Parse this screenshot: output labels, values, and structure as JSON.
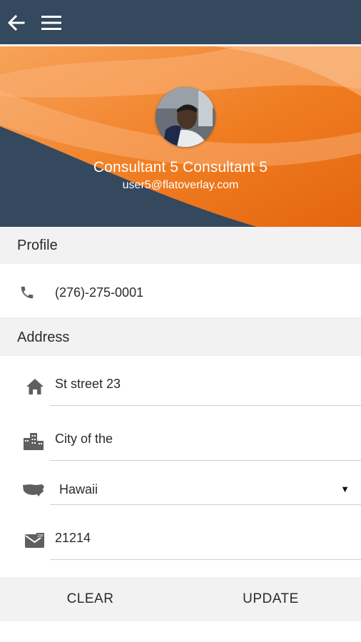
{
  "header": {
    "back_icon": "arrow-left-icon",
    "menu_icon": "hamburger-menu-icon",
    "bar_color": "#34485e"
  },
  "profile_card": {
    "name": "Consultant 5 Consultant 5",
    "email": "user5@flatoverlay.com",
    "accent_color": "#f07d22"
  },
  "sections": {
    "profile_title": "Profile",
    "address_title": "Address"
  },
  "profile": {
    "phone": "(276)-275-0001",
    "phone_icon": "phone-icon"
  },
  "address": {
    "street": "St street 23",
    "street_icon": "home-icon",
    "city": "City of the",
    "city_icon": "city-buildings-icon",
    "state": "Hawaii",
    "state_icon": "us-map-icon",
    "zip": "21214",
    "zip_icon": "zip-envelope-icon"
  },
  "actions": {
    "clear_label": "CLEAR",
    "update_label": "UPDATE"
  }
}
